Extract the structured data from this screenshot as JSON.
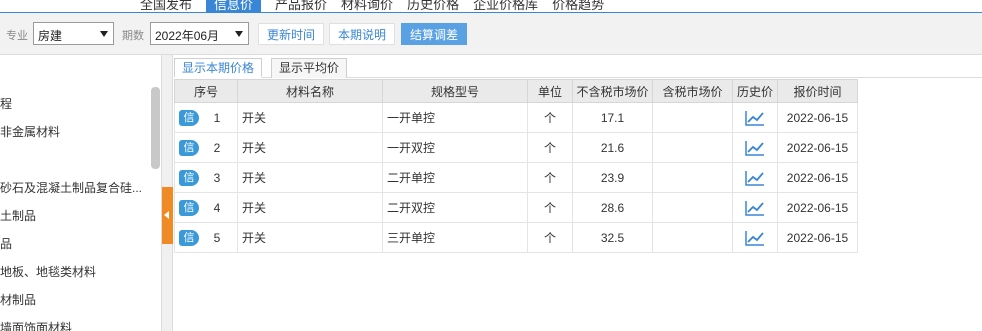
{
  "topnav": {
    "tabs": [
      "全国发布",
      "信息价",
      "产品报价",
      "材料询价",
      "历史价格",
      "企业价格库",
      "价格趋势"
    ],
    "active_index": 1
  },
  "toolbar": {
    "specialty_label": "专业",
    "specialty_value": "房建",
    "period_label": "期数",
    "period_value": "2022年06月",
    "update_time_label": "更新时间",
    "period_notes_label": "本期说明",
    "settlement_label": "结算调差"
  },
  "sidebar": {
    "items": [
      "程",
      "非金属材料",
      "",
      "砂石及混凝土制品复合硅...",
      "土制品",
      "品",
      "地板、地毯类材料",
      "材制品",
      "墙面饰面材料"
    ]
  },
  "subtabs": {
    "current_label": "显示本期价格",
    "average_label": "显示平均价"
  },
  "table": {
    "headers": [
      "序号",
      "材料名称",
      "规格型号",
      "单位",
      "不含税市场价",
      "含税市场价",
      "历史价",
      "报价时间"
    ],
    "badge_label": "信",
    "rows": [
      {
        "no": "1",
        "name": "开关",
        "spec": "一开单控",
        "unit": "个",
        "price_ex_tax": "17.1",
        "price_in_tax": "",
        "date": "2022-06-15"
      },
      {
        "no": "2",
        "name": "开关",
        "spec": "一开双控",
        "unit": "个",
        "price_ex_tax": "21.6",
        "price_in_tax": "",
        "date": "2022-06-15"
      },
      {
        "no": "3",
        "name": "开关",
        "spec": "二开单控",
        "unit": "个",
        "price_ex_tax": "23.9",
        "price_in_tax": "",
        "date": "2022-06-15"
      },
      {
        "no": "4",
        "name": "开关",
        "spec": "二开双控",
        "unit": "个",
        "price_ex_tax": "28.6",
        "price_in_tax": "",
        "date": "2022-06-15"
      },
      {
        "no": "5",
        "name": "开关",
        "spec": "三开单控",
        "unit": "个",
        "price_ex_tax": "32.5",
        "price_in_tax": "",
        "date": "2022-06-15"
      }
    ]
  },
  "icons": {
    "history": "trend-chart-icon",
    "dropdown": "caret-down-icon",
    "collapse": "triangle-left-icon"
  },
  "colors": {
    "accent": "#3a86d6",
    "badge": "#3a9ad9",
    "collapse": "#f08a24"
  }
}
